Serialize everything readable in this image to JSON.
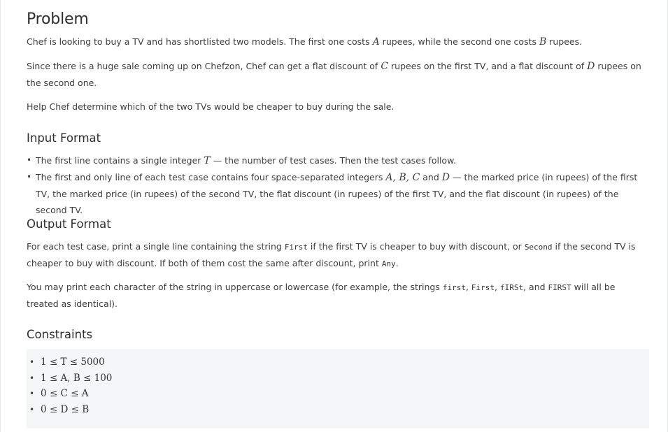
{
  "problem": {
    "title": "Problem",
    "p1": [
      "Chef is looking to buy a TV and has shortlisted two models. The first one costs ",
      "A",
      " rupees, while the second one costs ",
      "B",
      " rupees."
    ],
    "p2": [
      "Since there is a huge sale coming up on Chefzon, Chef can get a flat discount of ",
      "C",
      " rupees on the first TV, and a flat discount of ",
      "D",
      " rupees on the second one."
    ],
    "p3": "Help Chef determine which of the two TVs would be cheaper to buy during the sale."
  },
  "input_format": {
    "heading": "Input Format",
    "item1": [
      "The first line contains a single integer ",
      "T",
      " — the number of test cases. Then the test cases follow."
    ],
    "item2": [
      "The first and only line of each test case contains four space-separated integers ",
      "A, B, C",
      " and ",
      "D",
      " — the marked price (in rupees) of the first TV, the marked price (in rupees) of the second TV, the flat discount (in rupees) of the first TV, and the flat discount (in rupees) of the second TV."
    ]
  },
  "output_format": {
    "heading": "Output Format",
    "p1": [
      "For each test case, print a single line containing the string ",
      "First",
      " if the first TV is cheaper to buy with discount, or ",
      "Second",
      " if the second TV is cheaper to buy with discount. If both of them cost the same after discount, print ",
      "Any",
      "."
    ],
    "p2": [
      "You may print each character of the string in uppercase or lowercase (for example, the strings ",
      "first",
      ", ",
      "First",
      ", ",
      "fIRSt",
      ", and ",
      "FIRST",
      " will all be treated as identical)."
    ]
  },
  "constraints": {
    "heading": "Constraints",
    "items": [
      "1 ≤ T ≤ 5000",
      "1 ≤ A, B ≤ 100",
      "0 ≤ C ≤ A",
      "0 ≤ D ≤ B"
    ]
  }
}
